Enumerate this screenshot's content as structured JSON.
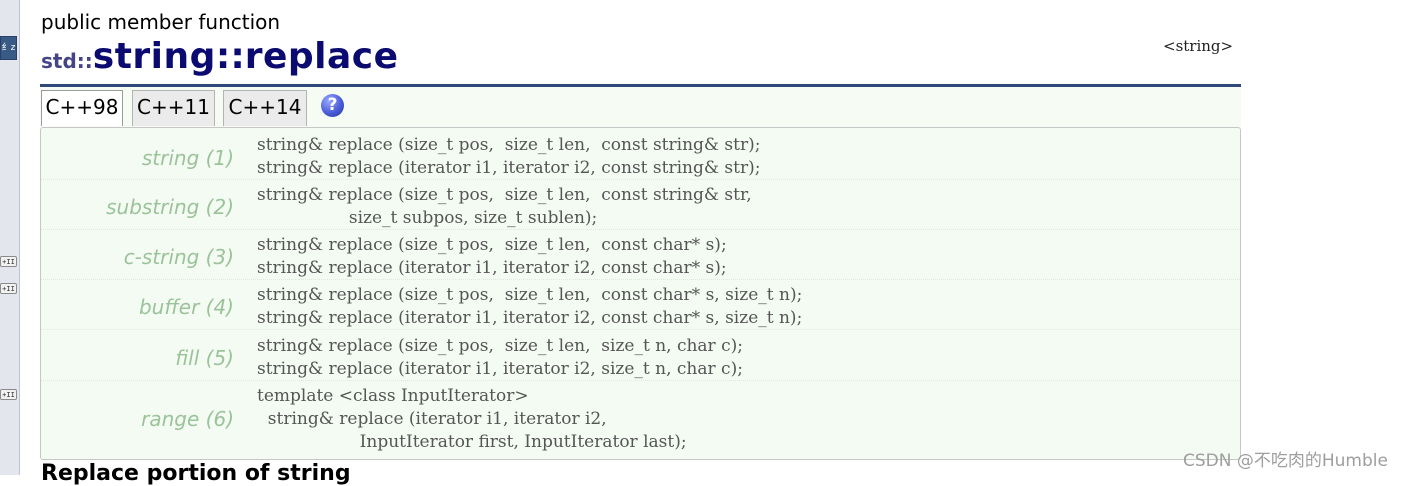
{
  "page": {
    "kind": "public member function",
    "namespace": "std::",
    "class_name": "string",
    "separator": "::",
    "function_name": "replace",
    "header": "<string>"
  },
  "tabs": [
    {
      "label": "C++98",
      "active": true
    },
    {
      "label": "C++11",
      "active": false
    },
    {
      "label": "C++14",
      "active": false
    }
  ],
  "help_icon": {
    "glyph": "?",
    "icon": "help-icon"
  },
  "gutter": {
    "top_glyph": "纟z",
    "buttons": [
      "+II",
      "+II",
      "+II"
    ]
  },
  "overloads": [
    {
      "label": "string (1)",
      "lines": [
        "string& replace (size_t pos,  size_t len,  const string& str);",
        "string& replace (iterator i1, iterator i2, const string& str);"
      ]
    },
    {
      "label": "substring (2)",
      "lines": [
        "string& replace (size_t pos,  size_t len,  const string& str,",
        "                 size_t subpos, size_t sublen);"
      ]
    },
    {
      "label": "c-string (3)",
      "lines": [
        "string& replace (size_t pos,  size_t len,  const char* s);",
        "string& replace (iterator i1, iterator i2, const char* s);"
      ]
    },
    {
      "label": "buffer (4)",
      "lines": [
        "string& replace (size_t pos,  size_t len,  const char* s, size_t n);",
        "string& replace (iterator i1, iterator i2, const char* s, size_t n);"
      ]
    },
    {
      "label": "fill (5)",
      "lines": [
        "string& replace (size_t pos,  size_t len,  size_t n, char c);",
        "string& replace (iterator i1, iterator i2, size_t n, char c);"
      ]
    },
    {
      "label": "range (6)",
      "lines": [
        "template <class InputIterator>",
        "  string& replace (iterator i1, iterator i2,",
        "                   InputIterator first, InputIterator last);"
      ]
    }
  ],
  "next_heading": "Replace portion of string",
  "watermark": "CSDN @不吃肉的Humble",
  "colors": {
    "title": "#0a0a70",
    "rule": "#2f4a7a",
    "panel_bg": "#f4fbf3",
    "label": "#9bc39a"
  }
}
